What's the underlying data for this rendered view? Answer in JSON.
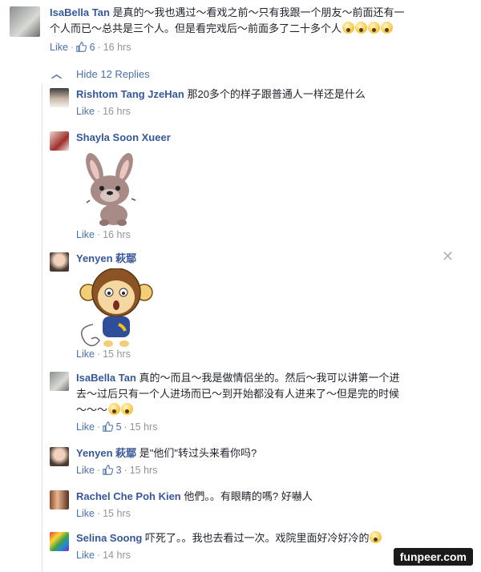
{
  "top": {
    "author": "IsaBella Tan",
    "text1": "是真的～我也遇过～看戏之前～只有我跟一个朋友～前面还有一",
    "text2": "个人而已～总共是三个人。但是看完戏后～前面多了二十多个人",
    "like": "Like",
    "count": "6",
    "time": "16 hrs"
  },
  "hide_replies": "Hide 12 Replies",
  "replies": [
    {
      "author": "Rishtom Tang JzeHan",
      "text": "那20多个的样子跟普通人一样还是什么",
      "like": "Like",
      "time": "16 hrs"
    },
    {
      "author": "Shayla Soon Xueer",
      "like": "Like",
      "time": "16 hrs"
    },
    {
      "author": "Yenyen 萩鄢",
      "like": "Like",
      "time": "15 hrs"
    },
    {
      "author": "IsaBella Tan",
      "text1": "真的～而且～我是做情侣坐的。然后～我可以讲第一个进",
      "text2": "去～过后只有一个人进场而已～到开始都没有人进来了～但是完的时候",
      "text3": "～～～",
      "like": "Like",
      "count": "5",
      "time": "15 hrs"
    },
    {
      "author": "Yenyen 萩鄢",
      "text": "是\"他们\"转过头来看你吗?",
      "like": "Like",
      "count": "3",
      "time": "15 hrs"
    },
    {
      "author": "Rachel Che Poh Kien",
      "text": "他們。。有眼睛的嗎? 好嚇人",
      "like": "Like",
      "time": "15 hrs"
    },
    {
      "author": "Selina Soong",
      "text": "吓死了。。我也去看过一次。戏院里面好冷好冷的",
      "like": "Like",
      "time": "14 hrs"
    }
  ],
  "watermark": "funpeer.com",
  "colors": {
    "link": "#365899",
    "meta": "#90949c",
    "like": "#4b6fa9"
  }
}
